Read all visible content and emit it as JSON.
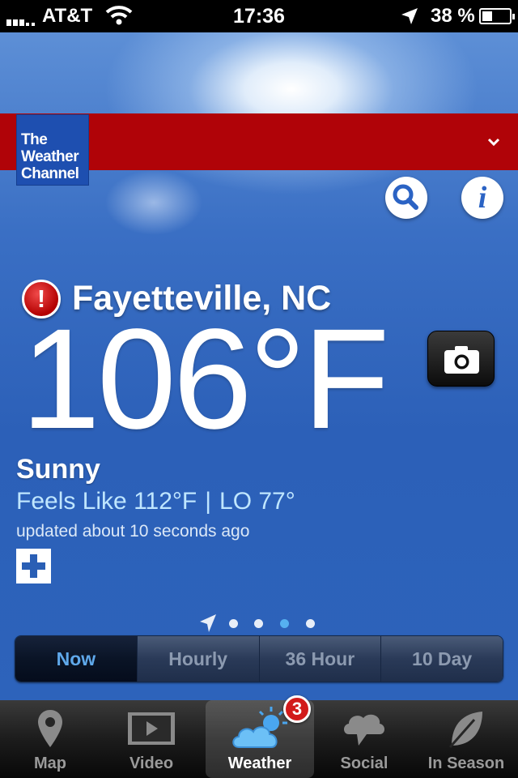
{
  "status_bar": {
    "carrier": "AT&T",
    "time": "17:36",
    "battery_percent": "38 %",
    "battery_level": 0.38,
    "icons": [
      "signal-icon",
      "wifi-icon",
      "location-arrow-icon",
      "battery-icon"
    ]
  },
  "header": {
    "logo_lines": [
      "The",
      "Weather",
      "Channel"
    ],
    "brand_color": "#b00308",
    "logo_color": "#1e4fb0",
    "icons": [
      "chevron-down-icon",
      "search-icon",
      "info-icon"
    ]
  },
  "current": {
    "location": "Fayetteville, NC",
    "temperature": "106°F",
    "condition": "Sunny",
    "feels_like": "Feels Like 112°F",
    "separator": "|",
    "low": "LO 77°",
    "updated": "updated about 10 seconds ago",
    "alert_icon_text": "!",
    "icons": [
      "alert-icon",
      "camera-icon",
      "plus-icon"
    ]
  },
  "pager": {
    "pages": 4,
    "active_page": 3
  },
  "forecast_tabs": [
    {
      "label": "Now",
      "active": true
    },
    {
      "label": "Hourly",
      "active": false
    },
    {
      "label": "36 Hour",
      "active": false
    },
    {
      "label": "10 Day",
      "active": false
    }
  ],
  "tab_bar": {
    "items": [
      {
        "label": "Map",
        "icon": "map-pin-icon",
        "active": false
      },
      {
        "label": "Video",
        "icon": "video-icon",
        "active": false
      },
      {
        "label": "Weather",
        "icon": "weather-icon",
        "active": true,
        "badge": "3"
      },
      {
        "label": "Social",
        "icon": "social-icon",
        "active": false
      },
      {
        "label": "In Season",
        "icon": "leaf-icon",
        "active": false
      }
    ]
  },
  "info_icon_text": "i"
}
